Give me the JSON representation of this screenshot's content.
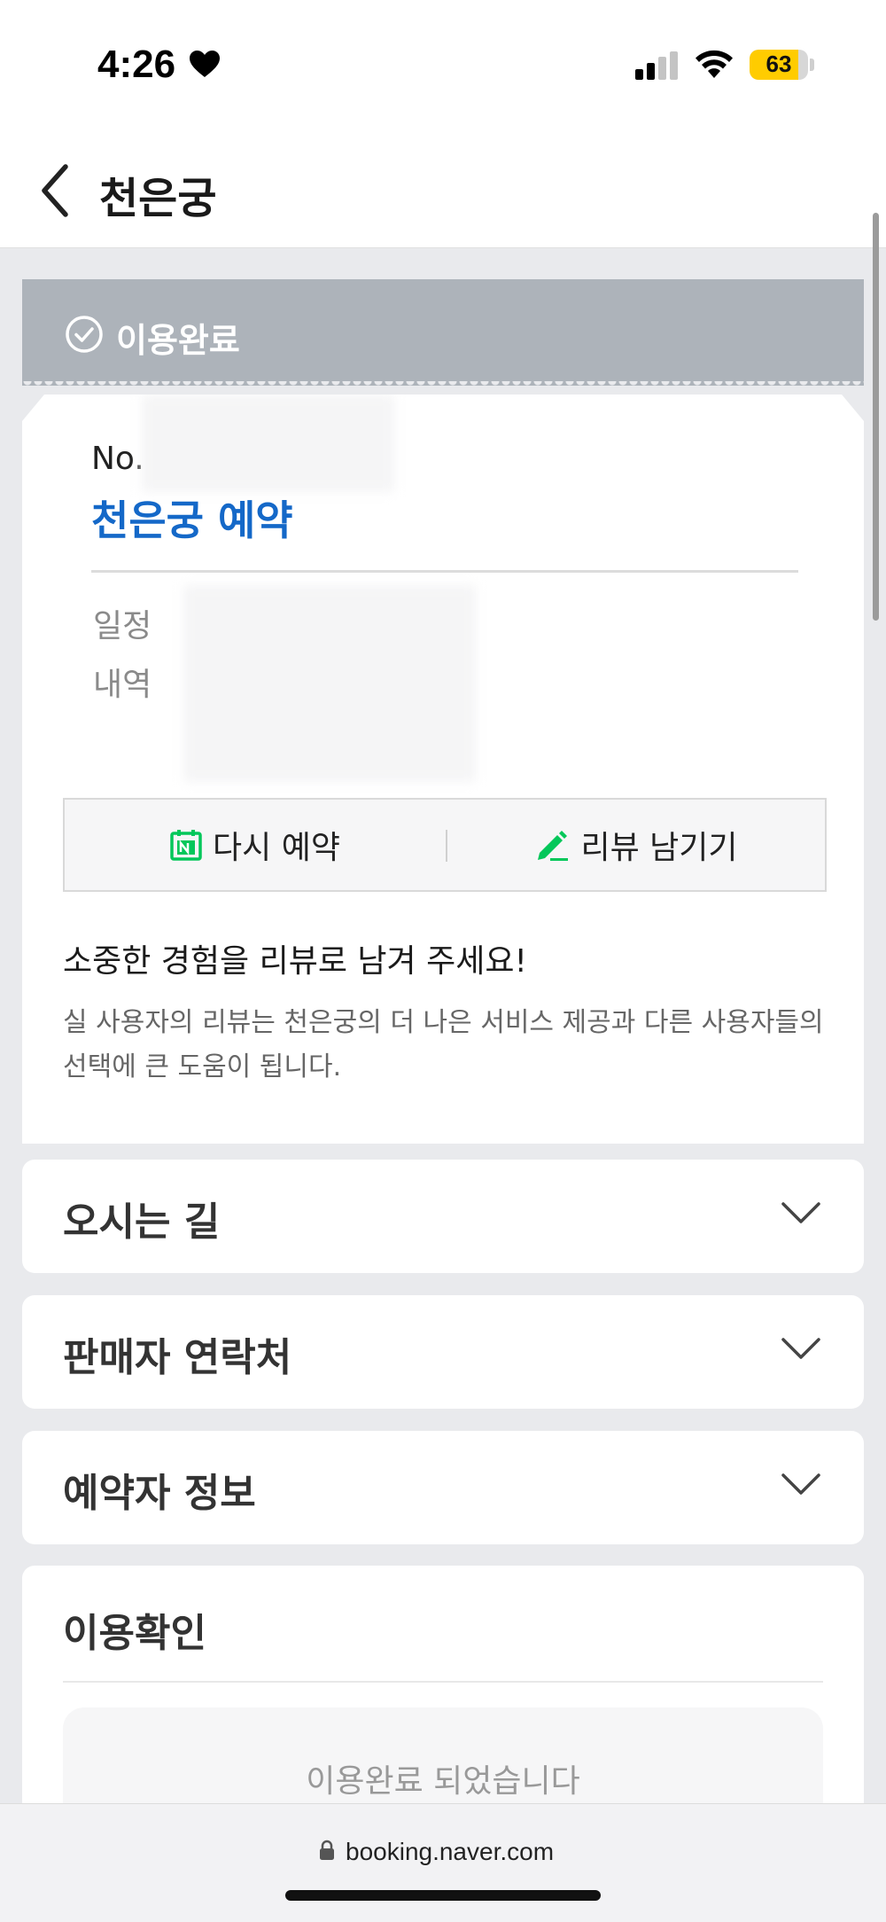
{
  "status_bar": {
    "time": "4:26",
    "battery": "63"
  },
  "header": {
    "title": "천은궁"
  },
  "banner": {
    "status": "이용완료"
  },
  "ticket": {
    "number_prefix": "No.",
    "title": "천은궁 예약",
    "schedule_label": "일정",
    "details_label": "내역",
    "actions": {
      "rebook": "다시 예약",
      "review": "리뷰 남기기"
    },
    "promo": {
      "title": "소중한 경험을 리뷰로 남겨 주세요!",
      "description": "실 사용자의 리뷰는 천은궁의 더 나은 서비스 제공과 다른 사용자들의 선택에 큰 도움이 됩니다."
    }
  },
  "sections": [
    {
      "label": "오시는 길"
    },
    {
      "label": "판매자 연락처"
    },
    {
      "label": "예약자 정보"
    }
  ],
  "confirm": {
    "title": "이용확인",
    "message": "이용완료 되었습니다"
  },
  "browser": {
    "url": "booking.naver.com"
  },
  "colors": {
    "accent_blue": "#1468c8",
    "banner_gray": "#adb3ba",
    "naver_green": "#03c75a",
    "battery_yellow": "#ffcc00"
  },
  "icons": {
    "back": "chevron-left-icon",
    "check": "check-circle-icon",
    "calendar": "naver-calendar-icon",
    "pencil": "pencil-icon",
    "chevron": "chevron-down-icon",
    "lock": "lock-icon"
  }
}
